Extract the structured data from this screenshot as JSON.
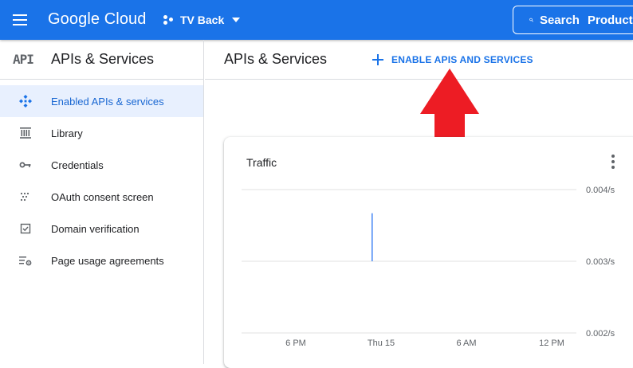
{
  "header": {
    "logo_text": "Google Cloud",
    "project_name": "TV Back",
    "search_label": "Search",
    "search_placeholder": "Products"
  },
  "sidebar": {
    "logo": "API",
    "title": "APIs & Services",
    "items": [
      {
        "label": "Enabled APIs & services",
        "icon": "enabled-apis-icon",
        "active": true
      },
      {
        "label": "Library",
        "icon": "library-icon",
        "active": false
      },
      {
        "label": "Credentials",
        "icon": "key-icon",
        "active": false
      },
      {
        "label": "OAuth consent screen",
        "icon": "oauth-dots-icon",
        "active": false
      },
      {
        "label": "Domain verification",
        "icon": "checkbox-icon",
        "active": false
      },
      {
        "label": "Page usage agreements",
        "icon": "settings-list-icon",
        "active": false
      }
    ]
  },
  "main": {
    "title": "APIs & Services",
    "enable_button": "ENABLE APIS AND SERVICES"
  },
  "card": {
    "title": "Traffic"
  },
  "colors": {
    "brand_blue": "#1a73e8",
    "active_bg": "#e8f0fe",
    "arrow_red": "#ed1c24",
    "series_line": "#4285f4"
  },
  "chart_data": {
    "type": "line",
    "title": "Traffic",
    "x_ticks": [
      "6 PM",
      "Thu 15",
      "6 AM",
      "12 PM"
    ],
    "y_ticks": [
      "0.004/s",
      "0.003/s",
      "0.002/s"
    ],
    "ylim": [
      0.002,
      0.004
    ],
    "series": [
      {
        "x": [
          0.39,
          0.39
        ],
        "values": [
          0.003,
          0.00367
        ]
      }
    ]
  }
}
